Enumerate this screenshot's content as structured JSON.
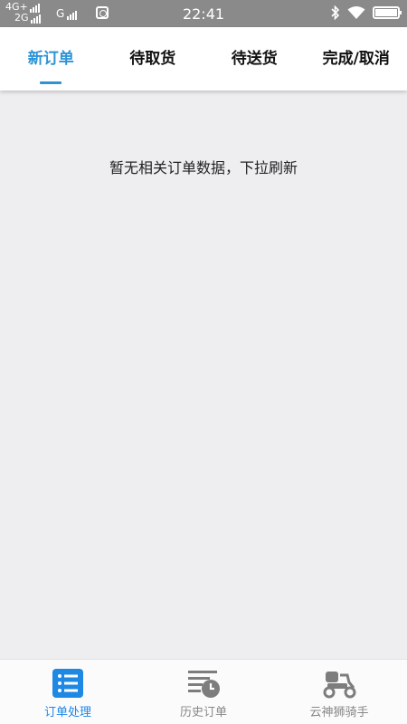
{
  "status_bar": {
    "network1": "4G+",
    "network2": "2G",
    "network3": "G",
    "time": "22:41"
  },
  "tabs": [
    {
      "label": "新订单",
      "active": true
    },
    {
      "label": "待取货",
      "active": false
    },
    {
      "label": "待送货",
      "active": false
    },
    {
      "label": "完成/取消",
      "active": false
    }
  ],
  "main": {
    "empty_message": "暂无相关订单数据，下拉刷新"
  },
  "bottom_nav": [
    {
      "label": "订单处理",
      "icon": "order-list-icon",
      "active": true
    },
    {
      "label": "历史订单",
      "icon": "history-icon",
      "active": false
    },
    {
      "label": "云神狮骑手",
      "icon": "scooter-icon",
      "active": false
    }
  ],
  "colors": {
    "accent": "#2b93d6",
    "nav_active": "#1e88e5",
    "background": "#eeedf0",
    "status_bar": "#8a8a8a"
  }
}
